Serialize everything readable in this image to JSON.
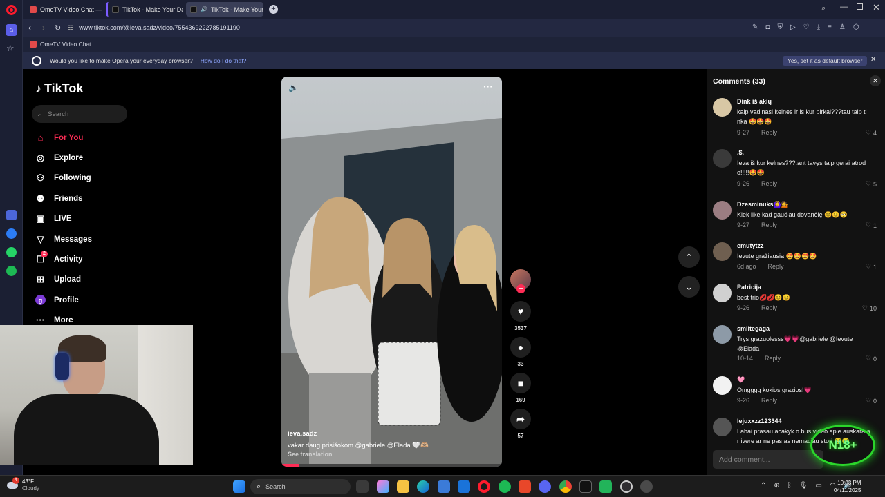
{
  "browser": {
    "tabs": [
      {
        "label": "OmeTV Video Chat — Or"
      },
      {
        "label": "TikTok - Make Your Day"
      },
      {
        "label": "TikTok - Make Your Da"
      }
    ],
    "url": "www.tiktok.com/@ieva.sadz/video/7554369222785191190",
    "bookmark": "OmeTV Video Chat...",
    "infobar": {
      "message": "Would you like to make Opera your everyday browser?",
      "link": "How do I do that?",
      "button": "Yes, set it as default browser"
    }
  },
  "tiktok": {
    "logo": "TikTok",
    "search_placeholder": "Search",
    "nav": [
      {
        "label": "For You",
        "icon": "home-icon"
      },
      {
        "label": "Explore",
        "icon": "compass-icon"
      },
      {
        "label": "Following",
        "icon": "following-icon"
      },
      {
        "label": "Friends",
        "icon": "friends-icon"
      },
      {
        "label": "LIVE",
        "icon": "live-icon"
      },
      {
        "label": "Messages",
        "icon": "messages-icon"
      },
      {
        "label": "Activity",
        "icon": "activity-icon",
        "badge": "2"
      },
      {
        "label": "Upload",
        "icon": "upload-icon"
      },
      {
        "label": "Profile",
        "icon": "profile-icon",
        "avatar_letter": "g"
      },
      {
        "label": "More",
        "icon": "more-icon"
      }
    ],
    "accent_color": "#fe2c55"
  },
  "video": {
    "author": "ieva.sadz",
    "caption": "vakar daug prisišokom  @gabriele  @Elada  🤍🫶🏼",
    "see_translation": "See translation",
    "likes": "3537",
    "comments": "33",
    "saves": "169",
    "shares": "57"
  },
  "comments_panel": {
    "title": "Comments (33)",
    "reply_label": "Reply",
    "add_placeholder": "Add comment...",
    "items": [
      {
        "user": "Dink iš akių",
        "text": "kaip vadinasi kelnes ir is kur pirkai???tau taip ti nka 🤩🤩🤩",
        "date": "9-27",
        "likes": "4"
      },
      {
        "user": ".$.",
        "text": "Ieva iš kur kelnes???.ant tavęs taip gerai atrod o!!!!!🤩🤩",
        "date": "9-26",
        "likes": "5"
      },
      {
        "user": "Dzesminuks🙆‍♀️💁",
        "text": "Kiek like kad gaučiau dovanėlę 😊😊🥺",
        "date": "9-27",
        "likes": "1"
      },
      {
        "user": "emutytzz",
        "text": "Ievute gražiausia 🤩🤩🤩🤩",
        "date": "6d ago",
        "likes": "1"
      },
      {
        "user": "Patricija",
        "text": "best trio💋💋😊😊",
        "date": "9-26",
        "likes": "10"
      },
      {
        "user": "smiltegaga",
        "text": "Trys grazuolesss💗💗@gabriele @Ievute @Elada",
        "date": "10-14",
        "likes": "0"
      },
      {
        "user": "🩷",
        "text": "Omgggg kokios grazios!💗",
        "date": "9-26",
        "likes": "0"
      },
      {
        "user": "lejuxxzz123344",
        "text": "Labai prasau acakyk o bus video apie auskara a r ivere ar ne pas as nemaciau stori 😭😭",
        "date": "",
        "likes": ""
      }
    ]
  },
  "overlay": {
    "badge": "N18+"
  },
  "taskbar": {
    "weather_temp": "43°F",
    "weather_desc": "Cloudy",
    "weather_badge": "4",
    "search_placeholder": "Search",
    "time": "10:03 PM",
    "date": "04/11/2025"
  }
}
